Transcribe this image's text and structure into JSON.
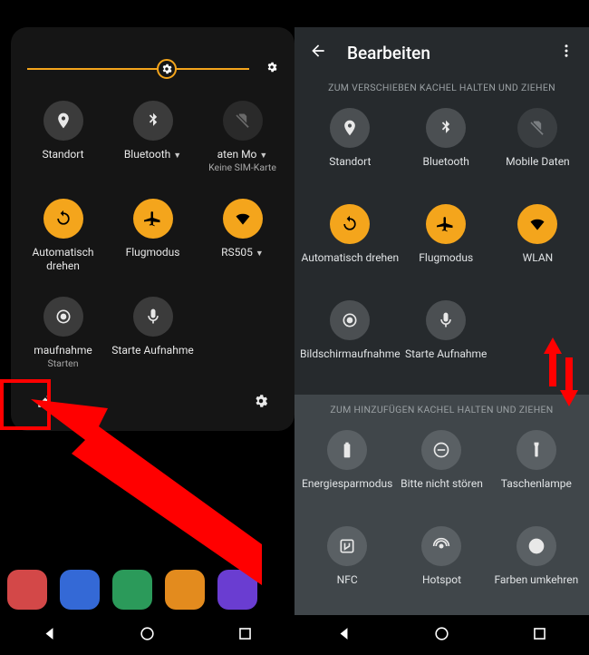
{
  "colors": {
    "accent": "#f4a51c",
    "highlight": "#ff0000"
  },
  "left_panel": {
    "brightness_percent": 63,
    "tiles": [
      {
        "icon": "location",
        "style": "grey",
        "label": "Standort",
        "caret": false
      },
      {
        "icon": "bluetooth",
        "style": "grey",
        "label": "Bluetooth",
        "caret": true
      },
      {
        "icon": "sim-off",
        "style": "dim",
        "label": "aten Mo",
        "caret": true,
        "sub": "Keine SIM-Karte"
      },
      {
        "icon": "rotate",
        "style": "orange",
        "label": "Automatisch drehen",
        "caret": false
      },
      {
        "icon": "airplane",
        "style": "orange",
        "label": "Flugmodus",
        "caret": false
      },
      {
        "icon": "wifi",
        "style": "orange",
        "label": "RS505",
        "caret": true
      },
      {
        "icon": "record",
        "style": "grey",
        "label": "maufnahme",
        "sub": "Starten"
      },
      {
        "icon": "mic",
        "style": "grey",
        "label": "Starte Aufnahme"
      }
    ],
    "footer": {
      "edit_icon": "pencil",
      "settings_icon": "gear"
    }
  },
  "right_screen": {
    "title": "Bearbeiten",
    "hint_top": "ZUM VERSCHIEBEN KACHEL HALTEN UND ZIEHEN",
    "tiles_top": [
      {
        "icon": "location",
        "style": "grey",
        "label": "Standort"
      },
      {
        "icon": "bluetooth",
        "style": "grey",
        "label": "Bluetooth"
      },
      {
        "icon": "sim-off",
        "style": "dim",
        "label": "Mobile Daten"
      },
      {
        "icon": "rotate",
        "style": "orange",
        "label": "Automatisch drehen"
      },
      {
        "icon": "airplane",
        "style": "orange",
        "label": "Flugmodus"
      },
      {
        "icon": "wifi",
        "style": "orange",
        "label": "WLAN"
      },
      {
        "icon": "record",
        "style": "grey",
        "label": "Bildschirmaufnahme"
      },
      {
        "icon": "mic",
        "style": "grey",
        "label": "Starte Aufnahme"
      }
    ],
    "hint_bottom": "ZUM HINZUFÜGEN KACHEL HALTEN UND ZIEHEN",
    "tiles_bottom": [
      {
        "icon": "battery",
        "style": "grey",
        "label": "Energiesparmodus"
      },
      {
        "icon": "dnd",
        "style": "grey",
        "label": "Bitte nicht stören"
      },
      {
        "icon": "torch",
        "style": "grey",
        "label": "Taschenlampe"
      },
      {
        "icon": "nfc",
        "style": "grey",
        "label": "NFC"
      },
      {
        "icon": "hotspot",
        "style": "grey",
        "label": "Hotspot"
      },
      {
        "icon": "invert",
        "style": "grey",
        "label": "Farben umkehren"
      }
    ]
  }
}
